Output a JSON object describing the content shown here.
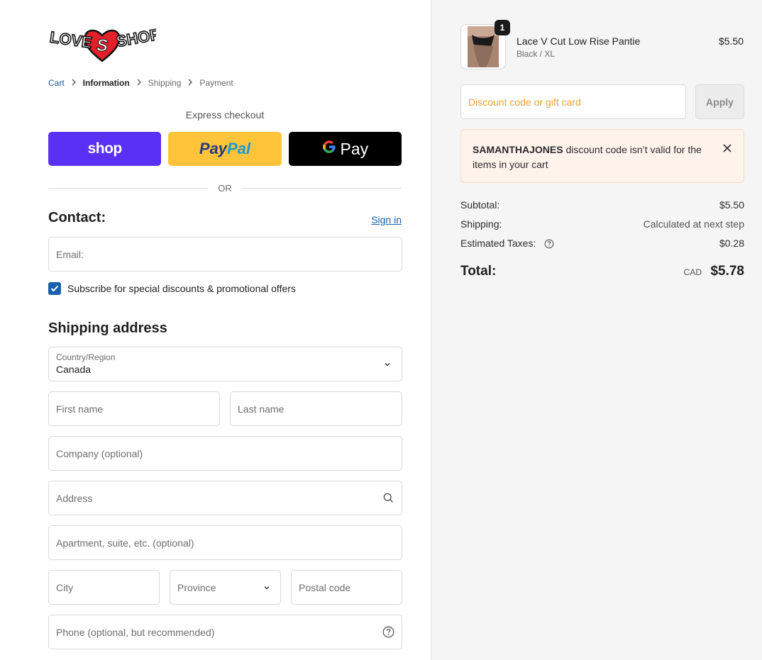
{
  "brand": {
    "logo_left": "LOVE",
    "logo_heart": "S",
    "logo_right": "SHOP"
  },
  "breadcrumb": [
    {
      "label": "Cart"
    },
    {
      "label": "Information"
    },
    {
      "label": "Shipping"
    },
    {
      "label": "Payment"
    }
  ],
  "express": {
    "label": "Express checkout",
    "shop_label": "shop",
    "paypal_part1": "Pay",
    "paypal_part2": "Pal",
    "gpay_label": "Pay"
  },
  "or_label": "OR",
  "contact": {
    "title": "Contact:",
    "signin_label": "Sign in",
    "email_placeholder": "Email:",
    "subscribe_label": "Subscribe for special discounts & promotional offers",
    "subscribe_checked": true
  },
  "shipping": {
    "title": "Shipping address",
    "country_label": "Country/Region",
    "country_value": "Canada",
    "first_name_placeholder": "First name",
    "last_name_placeholder": "Last name",
    "company_placeholder": "Company (optional)",
    "address_placeholder": "Address",
    "apartment_placeholder": "Apartment, suite, etc. (optional)",
    "city_placeholder": "City",
    "province_placeholder": "Province",
    "postal_placeholder": "Postal code",
    "phone_placeholder": "Phone (optional, but recommended)"
  },
  "cart": {
    "item": {
      "name": "Lace V Cut Low Rise Pantie",
      "variant": "Black / XL",
      "price": "$5.50",
      "quantity": "1"
    },
    "discount_placeholder": "Discount code or gift card",
    "apply_label": "Apply",
    "alert": {
      "code": "SAMANTHAJONES",
      "message": " discount code isn’t valid for the items in your cart"
    },
    "subtotal_label": "Subtotal:",
    "subtotal_value": "$5.50",
    "shipping_label": "Shipping:",
    "shipping_value": "Calculated at next step",
    "taxes_label": "Estimated Taxes:",
    "taxes_value": "$0.28",
    "total_label": "Total:",
    "total_currency": "CAD",
    "total_value": "$5.78"
  },
  "colors": {
    "link": "#1a5fa8",
    "shop_pay": "#5a31f4",
    "paypal": "#ffc439",
    "alert_bg": "#fff3ec"
  }
}
